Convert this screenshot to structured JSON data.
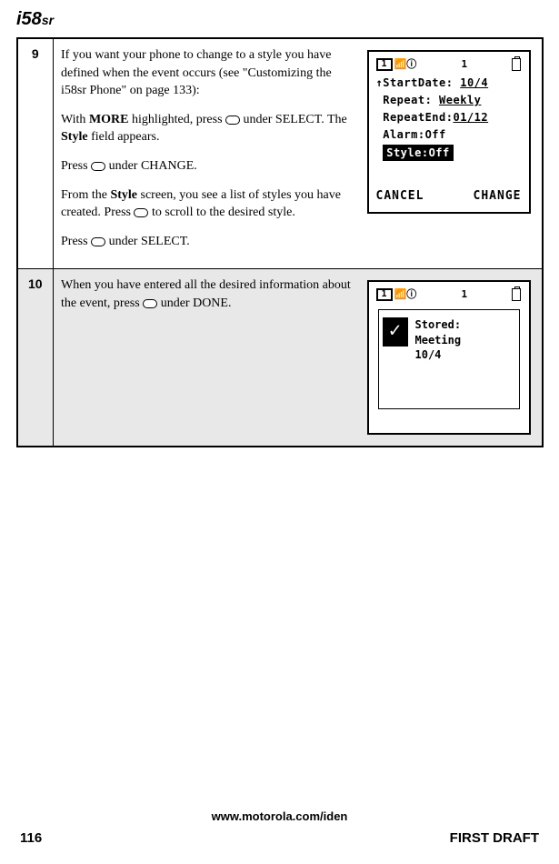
{
  "header": {
    "model": "i58",
    "suffix": "sr"
  },
  "steps": [
    {
      "num": "9",
      "paragraphs": {
        "p1_pre": "If you want your phone to change to a style you have defined when the event occurs (see \"Customizing the i58sr Phone\" on page 133):",
        "p2_pre": "With ",
        "p2_bold1": "MORE",
        "p2_mid1": " highlighted, press ",
        "p2_post1": " under SELECT. The ",
        "p2_bold2": "Style",
        "p2_post2": " field appears.",
        "p3_pre": "Press ",
        "p3_post": " under CHANGE.",
        "p4_pre": "From the ",
        "p4_bold": "Style",
        "p4_mid": " screen, you see a list of styles you have created. Press ",
        "p4_post": " to scroll to the desired style.",
        "p5_pre": "Press ",
        "p5_post": " under SELECT."
      },
      "screen": {
        "status_num": "1",
        "line1_label": "StartDate:",
        "line1_val": "10/4",
        "line2_label": "Repeat:",
        "line2_val": "Weekly",
        "line3_label": "RepeatEnd:",
        "line3_val": "01/12",
        "line4": "Alarm:Off",
        "line5": "Style:Off",
        "btn_left": "CANCEL",
        "btn_right": "CHANGE"
      }
    },
    {
      "num": "10",
      "paragraphs": {
        "p1_pre": "When you have entered all the desired information about the event, press ",
        "p1_post": " under DONE."
      },
      "screen": {
        "status_num": "1",
        "stored_label": "Stored:",
        "stored_title": "Meeting",
        "stored_date": "10/4"
      }
    }
  ],
  "footer": {
    "url": "www.motorola.com/iden",
    "page": "116",
    "draft": "FIRST DRAFT"
  }
}
